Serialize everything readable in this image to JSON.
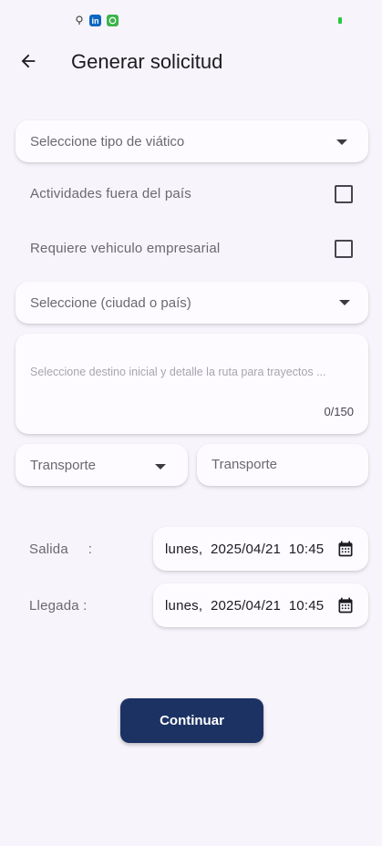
{
  "header": {
    "title": "Generar solicitud"
  },
  "form": {
    "tipo_viatico": {
      "placeholder": "Seleccione tipo de viático"
    },
    "actividades_fuera": {
      "label": "Actividades fuera del país",
      "checked": false
    },
    "vehiculo_empresarial": {
      "label": "Requiere vehiculo empresarial",
      "checked": false
    },
    "destino": {
      "placeholder": "Seleccione (ciudad o país)"
    },
    "ruta": {
      "placeholder": "Seleccione destino inicial y detalle la ruta para trayectos ...",
      "counter": "0/150"
    },
    "transporte_select": {
      "placeholder": "Transporte"
    },
    "transporte_input": {
      "placeholder": "Transporte"
    },
    "salida": {
      "label": "Salida     :",
      "value": "lunes,  2025/04/21  10:45"
    },
    "llegada": {
      "label": "Llegada :",
      "value": "lunes,  2025/04/21  10:45"
    }
  },
  "actions": {
    "continue_label": "Continuar"
  },
  "colors": {
    "primary": "#1b3263",
    "background": "#f8f4fb",
    "linkedin": "#0a66c2",
    "green": "#3bb44a"
  },
  "icons": [
    "back-arrow-icon",
    "dropdown-arrow-icon",
    "calendar-icon",
    "linkedin-icon",
    "whatsapp-icon"
  ]
}
